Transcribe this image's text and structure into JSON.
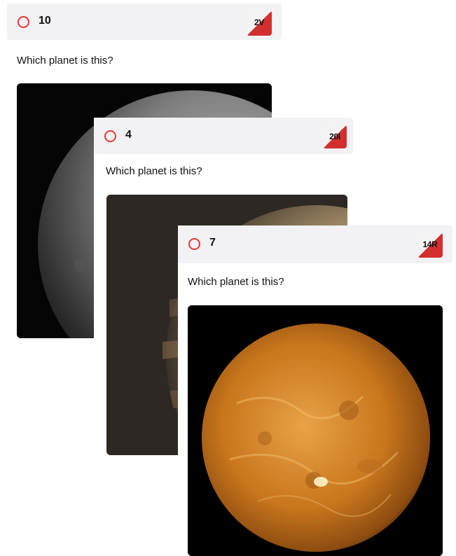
{
  "cards": [
    {
      "number": "10",
      "badge": "2V",
      "question": "Which planet is this?",
      "planet_icon": "mercury-image"
    },
    {
      "number": "4",
      "badge": "20I",
      "question": "Which planet is this?",
      "planet_icon": "jupiter-image"
    },
    {
      "number": "7",
      "badge": "14R",
      "question": "Which planet is this?",
      "planet_icon": "venus-image"
    }
  ],
  "colors": {
    "accent_red": "#e53935",
    "header_bg": "#f2f2f4",
    "badge_red": "#d32f2f"
  }
}
